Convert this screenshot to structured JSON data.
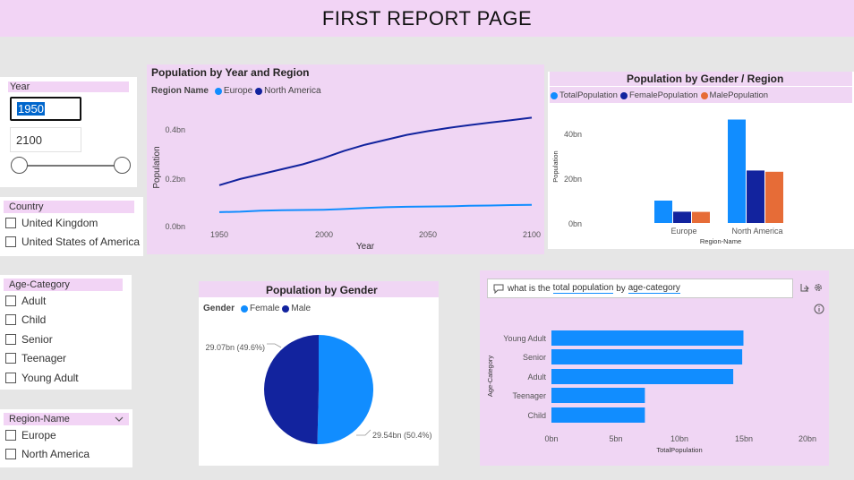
{
  "page": {
    "title": "FIRST REPORT PAGE"
  },
  "year_slicer": {
    "header": "Year",
    "start": "1950",
    "end": "2100",
    "range": [
      0,
      1
    ]
  },
  "country_slicer": {
    "header": "Country",
    "items": [
      "United Kingdom",
      "United States of America"
    ]
  },
  "age_slicer": {
    "header": "Age-Category",
    "items": [
      "Adult",
      "Child",
      "Senior",
      "Teenager",
      "Young Adult"
    ]
  },
  "region_slicer": {
    "header": "Region-Name",
    "items": [
      "Europe",
      "North America"
    ],
    "chevron": "chevron-down-icon"
  },
  "colors": {
    "blue": "#118dff",
    "navy": "#12239e",
    "orange": "#e66c37",
    "pink": "#f0d6f4"
  },
  "line_chart": {
    "title": "Population by Year and Region",
    "legend_title": "Region Name",
    "legend_items": [
      "Europe",
      "North America"
    ],
    "xlabel": "Year",
    "ylabel": "Population",
    "x_ticks": [
      "1950",
      "2000",
      "2050",
      "2100"
    ],
    "y_ticks": [
      "0.0bn",
      "0.2bn",
      "0.4bn"
    ]
  },
  "bar_chart": {
    "title": "Population by Gender / Region",
    "legend_items": [
      "TotalPopulation",
      "FemalePopulation",
      "MalePopulation"
    ],
    "xlabel": "Region-Name",
    "ylabel": "Population",
    "categories": [
      "Europe",
      "North America"
    ],
    "y_ticks": [
      "0bn",
      "20bn",
      "40bn"
    ]
  },
  "pie_chart": {
    "title": "Population by Gender",
    "legend_title": "Gender",
    "legend_items": [
      "Female",
      "Male"
    ],
    "label_male": "29.07bn (49.6%)",
    "label_female": "29.54bn (50.4%)"
  },
  "qna": {
    "question_prefix": "what is the ",
    "question_term1": "total population",
    "question_mid": " by ",
    "question_term2": "age-category",
    "xlabel": "TotalPopulation",
    "ylabel": "Age-Category",
    "x_ticks": [
      "0bn",
      "5bn",
      "10bn",
      "15bn",
      "20bn"
    ],
    "icons": [
      "chat-icon",
      "share-icon",
      "settings-icon",
      "info-icon"
    ]
  },
  "chart_data": [
    {
      "type": "line",
      "title": "Population by Year and Region",
      "xlabel": "Year",
      "ylabel": "Population",
      "xlim": [
        1950,
        2100
      ],
      "ylim": [
        0,
        0.5
      ],
      "x": [
        1950,
        1960,
        1970,
        1980,
        1990,
        2000,
        2010,
        2020,
        2030,
        2040,
        2050,
        2060,
        2070,
        2080,
        2090,
        2100
      ],
      "series": [
        {
          "name": "Europe",
          "values": [
            0.055,
            0.057,
            0.061,
            0.063,
            0.064,
            0.065,
            0.068,
            0.072,
            0.075,
            0.077,
            0.078,
            0.079,
            0.081,
            0.082,
            0.084,
            0.085
          ]
        },
        {
          "name": "North America",
          "values": [
            0.165,
            0.19,
            0.21,
            0.23,
            0.25,
            0.275,
            0.305,
            0.33,
            0.35,
            0.37,
            0.385,
            0.398,
            0.41,
            0.42,
            0.43,
            0.44
          ]
        }
      ]
    },
    {
      "type": "bar",
      "title": "Population by Gender / Region",
      "xlabel": "Region-Name",
      "ylabel": "Population",
      "categories": [
        "Europe",
        "North America"
      ],
      "ylim": [
        0,
        55
      ],
      "series": [
        {
          "name": "TotalPopulation",
          "values": [
            10.5,
            48.5
          ]
        },
        {
          "name": "FemalePopulation",
          "values": [
            5.3,
            24.6
          ]
        },
        {
          "name": "MalePopulation",
          "values": [
            5.2,
            24.0
          ]
        }
      ]
    },
    {
      "type": "pie",
      "title": "Population by Gender",
      "categories": [
        "Female",
        "Male"
      ],
      "values": [
        29.54,
        29.07
      ]
    },
    {
      "type": "bar",
      "title": "",
      "orientation": "horizontal",
      "xlabel": "TotalPopulation",
      "ylabel": "Age-Category",
      "categories": [
        "Young Adult",
        "Senior",
        "Adult",
        "Teenager",
        "Child"
      ],
      "values": [
        15.0,
        14.9,
        14.2,
        7.3,
        7.3
      ],
      "xlim": [
        0,
        20
      ]
    }
  ]
}
